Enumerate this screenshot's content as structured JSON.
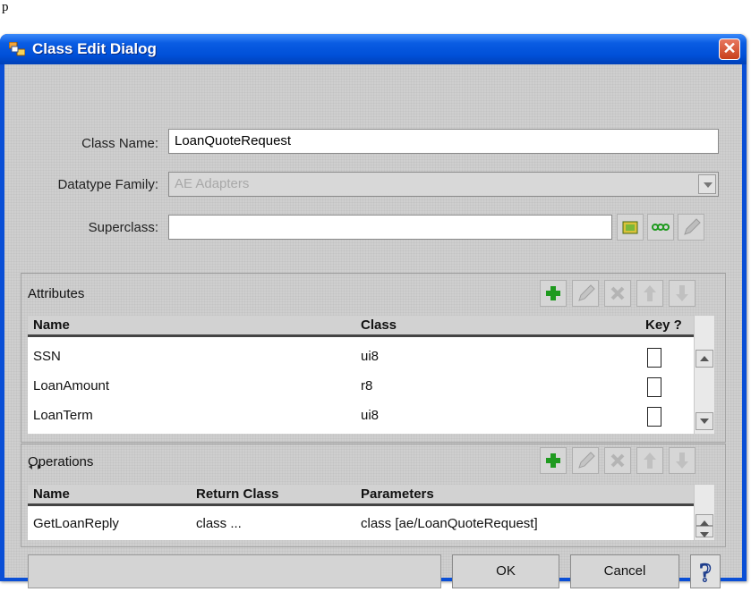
{
  "caption": "p",
  "window": {
    "title": "Class Edit Dialog"
  },
  "form": {
    "class_name_label": "Class Name:",
    "class_name_value": "LoanQuoteRequest",
    "datatype_family_label": "Datatype Family:",
    "datatype_family_value": "AE Adapters",
    "superclass_label": "Superclass:",
    "superclass_value": ""
  },
  "attributes": {
    "title": "Attributes",
    "columns": {
      "name": "Name",
      "class": "Class",
      "key": "Key ?"
    },
    "rows": [
      {
        "name": "SSN",
        "class": "ui8"
      },
      {
        "name": "LoanAmount",
        "class": "r8"
      },
      {
        "name": "LoanTerm",
        "class": "ui8"
      }
    ]
  },
  "operations": {
    "title": "Operations",
    "columns": {
      "name": "Name",
      "return_class": "Return Class",
      "parameters": "Parameters"
    },
    "rows": [
      {
        "name": "GetLoanReply",
        "return_class": "class ...",
        "parameters": "class [ae/LoanQuoteRequest]"
      }
    ]
  },
  "buttons": {
    "ok": "OK",
    "cancel": "Cancel"
  },
  "colors": {
    "titlebar": "#0050d8",
    "close": "#c8401c",
    "add": "#1f9a1f",
    "dialog_bg": "#cfcfcf"
  }
}
